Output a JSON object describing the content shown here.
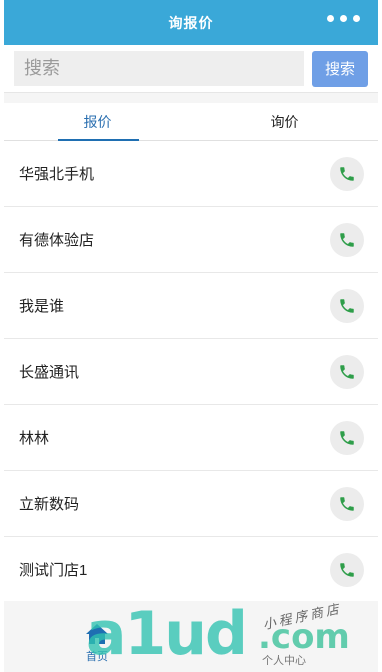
{
  "header": {
    "title": "询报价"
  },
  "search": {
    "placeholder": "搜索",
    "button_label": "搜索"
  },
  "tabs": [
    {
      "label": "报价",
      "active": true
    },
    {
      "label": "询价",
      "active": false
    }
  ],
  "stores": [
    {
      "name": "华强北手机"
    },
    {
      "name": "有德体验店"
    },
    {
      "name": "我是谁"
    },
    {
      "name": "长盛通讯"
    },
    {
      "name": "林林"
    },
    {
      "name": "立新数码"
    },
    {
      "name": "测试门店1"
    }
  ],
  "bottom_nav": {
    "home_label": "首页",
    "me_label": "个人中心"
  },
  "watermark": {
    "text": "a1ud",
    "dotcom": ".com",
    "subtitle": "小程序商店"
  },
  "colors": {
    "header": "#3aa8d8",
    "search_button": "#6f9fe6",
    "active_tab": "#2a6fb0",
    "phone_icon": "#2f9e4a"
  }
}
